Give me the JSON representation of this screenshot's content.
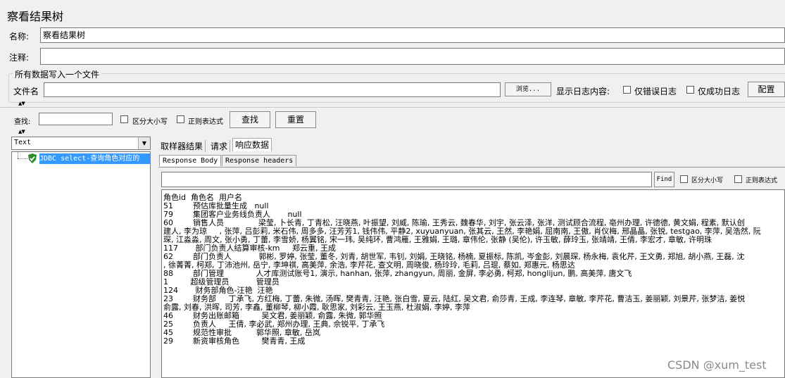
{
  "window": {
    "title": "察看结果树"
  },
  "form": {
    "name_label": "名称:",
    "name_value": "察看结果树",
    "comment_label": "注释:",
    "comment_value": ""
  },
  "file_group": {
    "title": "所有数据写入一个文件",
    "filename_label": "文件名",
    "filename_value": "",
    "browse_label": "浏览...",
    "log_label": "显示日志内容:",
    "errors_only_label": "仅错误日志",
    "success_only_label": "仅成功日志",
    "config_label": "配置"
  },
  "search": {
    "label": "查找:",
    "value": "",
    "case_label": "区分大小写",
    "regex_label": "正则表达式",
    "find_label": "查找",
    "reset_label": "重置"
  },
  "tree": {
    "renderer_value": "Text",
    "items": [
      {
        "label": "JDBC select-查询角色对应的",
        "status": "success"
      }
    ]
  },
  "result_tabs": [
    "取样器结果",
    "请求",
    "响应数据"
  ],
  "response_tabs": [
    "Response Body",
    "Response headers"
  ],
  "response_search": {
    "find_label": "Find",
    "case_label": "区分大小写",
    "regex_label": "正则表达式"
  },
  "response_lines": [
    "角色id  角色名  用户名",
    "51        预估库批量生成   null",
    "79        集团客户业务线负责人       null",
    "60        销售人员              梁莹, 卜长青, 丁青松, 汪晓燕, 叶振望, 刘威, 陈瑜, 王秀云, 魏春华, 刘宇, 张云泽, 张洋, 测试顾合流程, 亳州办理, 许德德, 黄文娟, 程素, 默认创",
    "建人, 李为琼     , 张萍, 吕彭莉, 米石伟, 周多多, 汪芳芳1, 钱伟伟, 平静2, xuyuanyuan, 张其云, 王然, 李艳娟, 屈南南, 王傲, 肖仪梅, 邢晶晶, 张锐, testgao, 李萍, 吴浩然, 阮",
    "琛, 江淼淼, 周文, 张小勇, 丁蕾, 李雪娇, 杨翼铭, 宋一玮, 吴纯环, 曹鸿雁, 王雅娟, 王璐, 章伟伦, 张静 (吴伦), 许玉敏, 薛玲玉, 张靖靖, 王倩, 李宏才, 章敏, 许明珠",
    "117       部门负责人结算审核-km     郑云重, 王成",
    "62        部门负责人           郭彬, 罗婷, 张莹, 董冬, 刘青, 胡世军, 韦钊, 刘娟, 王晓铭, 杨楠, 夏振标, 陈凯, 岑金彭, 刘晨琛, 杨永梅, 袁化芹, 王文勇, 郑旭, 胡小燕, 王磊, 沈",
    ", 徐菁菁, 柯郑, 丁沛池州, 岳宁, 李坤祺, 高美萍, 余浩, 李芹花, 查文明, 周晓俊, 杨玲玲, 毛莉, 吕琨, 蔡如, 郑惠元, 杨思达",
    "88        部门管理             人才库测试账号1, 演示, hanhan, 张萍, zhangyun, 周丽, 金屏, 李必勇, 柯郑, honglijun, 鹏, 高美萍, 唐文飞",
    "1         超级管理员           管理员",
    "124       财务部角色-汪艳  汪艳",
    "23        财务部     丁承飞, 方红梅, 丁蕾, 朱微, 汤晖, 樊青青, 汪艳, 张白雪, 夏云, 陆红, 吴文君, 俞莎青, 王成, 李连琴, 章敏, 李芹花, 曹洁玉, 姜丽颖, 刘景芹, 张梦洁, 姜悦",
    "俞露, 刘春, 洪晖, 司芳, 李鑫, 董柳琴, 柳小霞, 耿思家, 刘彩云, 王玉燕, 杜淑娟, 李婷, 李萍",
    "46        财务出账邮箱         吴文君, 姜丽颖, 俞露, 朱微, 郭华照",
    "25        负责人     王倩, 李必武, 郑州办理, 王典, 佘锐平, 丁承飞",
    "45        规范性审批          郭华照, 章敏, 岳岚",
    "29        新资审核角色         樊青青, 王成"
  ],
  "watermark": "CSDN @xum_test"
}
